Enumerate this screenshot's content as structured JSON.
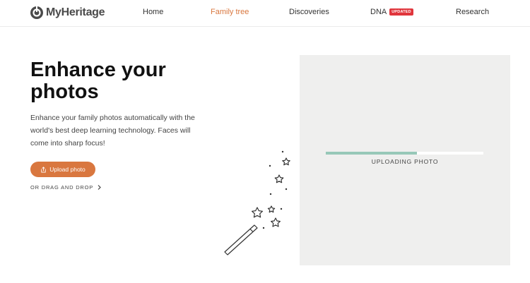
{
  "header": {
    "brand": "MyHeritage",
    "nav": {
      "home": "Home",
      "family_tree": "Family tree",
      "discoveries": "Discoveries",
      "dna": "DNA",
      "dna_badge": "UPDATED",
      "research": "Research"
    },
    "active_nav": "family_tree"
  },
  "hero": {
    "title": "Enhance your photos",
    "description": "Enhance your family photos automatically with the world's best deep learning technology. Faces will come into sharp focus!",
    "upload_button": "Upload photo",
    "drag_drop": "OR DRAG AND DROP"
  },
  "upload_panel": {
    "status_label": "UPLOADING PHOTO",
    "progress": 0.58
  },
  "icons": {
    "logo": "myheritage-logo-icon",
    "upload": "upload-icon",
    "chevron": "chevron-right-icon",
    "wand": "magic-wand-icon"
  },
  "colors": {
    "accent": "#d9773f",
    "badge": "#e0353c",
    "progress": "#97c8b8",
    "panel": "#efefee"
  }
}
